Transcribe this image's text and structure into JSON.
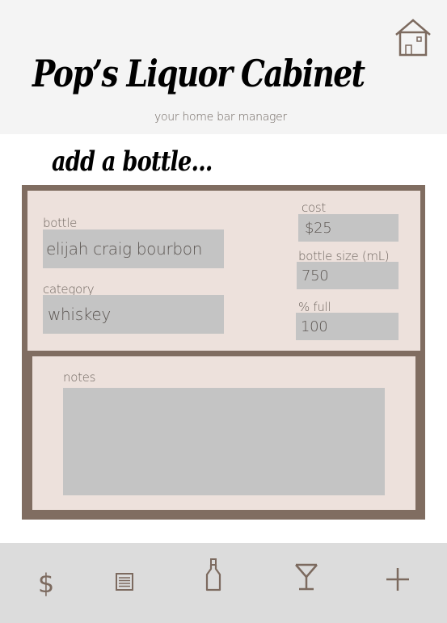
{
  "header": {
    "title": "Pop’s Liquor Cabinet",
    "subtitle": "your home bar manager"
  },
  "section": {
    "title": "add a bottle..."
  },
  "form": {
    "bottle_label": "bottle",
    "bottle_value": "elijah craig bourbon",
    "category_label": "category",
    "category_value": "whiskey",
    "cost_label": "cost",
    "cost_value": "$25",
    "size_label": "bottle size (mL)",
    "size_value": "750",
    "full_label": "% full",
    "full_value": "100",
    "notes_label": "notes",
    "notes_value": ""
  },
  "nav": {
    "dollar_glyph": "$",
    "items": [
      "prices",
      "list",
      "bottles",
      "cocktails",
      "add"
    ]
  },
  "colors": {
    "frame": "#806d61",
    "panel": "#ede1dc",
    "field": "#c4c4c4",
    "icon": "#7c6a5f",
    "header_bg": "#f4f4f4",
    "nav_bg": "#dcdcdc"
  }
}
